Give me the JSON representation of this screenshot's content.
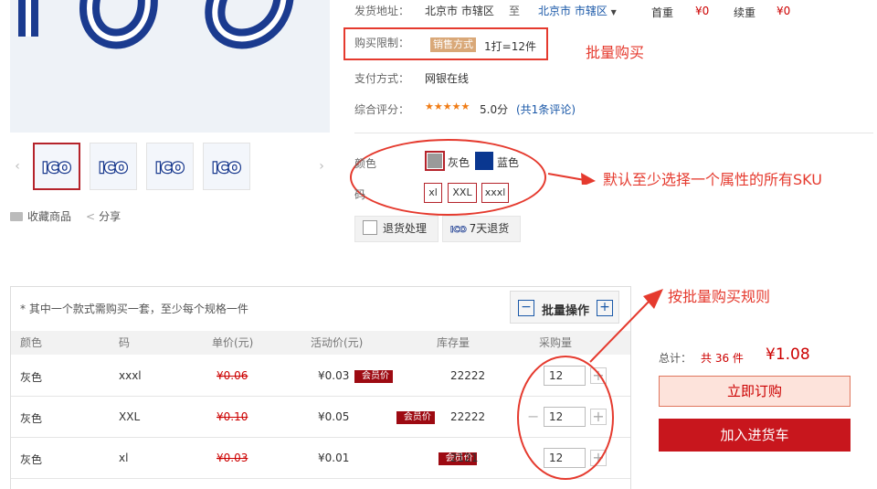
{
  "gallery": {
    "thumbs": [
      "ICO",
      "ICO",
      "ICO",
      "ICO"
    ],
    "favorite": "收藏商品",
    "share": "分享"
  },
  "shipping": {
    "label": "发货地址：",
    "from": "北京市 市辖区",
    "to_sep": "至",
    "to": "北京市 市辖区",
    "first_label": "首重",
    "first_price": "¥0",
    "extra_label": "续重",
    "extra_price": "¥0"
  },
  "purchase_limit": {
    "label": "购买限制：",
    "tag": "销售方式",
    "rule": "1打=12件"
  },
  "payment": {
    "label": "支付方式：",
    "value": "网银在线"
  },
  "rating": {
    "label": "综合评分：",
    "stars": "★★★★★",
    "score": "5.0分",
    "reviews": "(共1条评论)"
  },
  "sku": {
    "color_label": "颜色",
    "colors": [
      {
        "name": "灰色",
        "swatch": "#9a9a9a"
      },
      {
        "name": "蓝色",
        "swatch": "#0a3790"
      }
    ],
    "size_label": "码",
    "sizes": [
      "xl",
      "XXL",
      "xxxl"
    ]
  },
  "services": {
    "return": "退货处理",
    "seven_day": "7天退货",
    "seven_day_badge": "ICO"
  },
  "batch": {
    "note": "* 其中一个款式需购买一套，至少每个规格一件",
    "title": "批量操作",
    "minus": "−",
    "plus": "+"
  },
  "table": {
    "headers": [
      "颜色",
      "码",
      "单价(元)",
      "活动价(元)",
      "库存量",
      "采购量"
    ],
    "vip_label": "会员价",
    "rows": [
      {
        "color": "灰色",
        "size": "xxxl",
        "price": "¥0.06",
        "promo": "¥0.03",
        "stock": "22222",
        "qty": "12"
      },
      {
        "color": "灰色",
        "size": "XXL",
        "price": "¥0.10",
        "promo": "¥0.05",
        "stock": "22222",
        "qty": "12"
      },
      {
        "color": "灰色",
        "size": "xl",
        "price": "¥0.03",
        "promo": "¥0.01",
        "stock": "2121",
        "qty": "12"
      }
    ],
    "minus": "−",
    "plus": "+"
  },
  "summary": {
    "total_label": "总计：",
    "count": "共 36 件",
    "amount": "¥1.08",
    "order_button": "立即订购",
    "cart_button": "加入进货车"
  },
  "annotations": {
    "batch_buy": "批量购买",
    "default_sku": "默认至少选择一个属性的所有SKU",
    "batch_rule": "按批量购买规则"
  },
  "colors": {
    "accent": "#c8161d",
    "annotation": "#e53a2e",
    "link": "#1a58a8"
  }
}
